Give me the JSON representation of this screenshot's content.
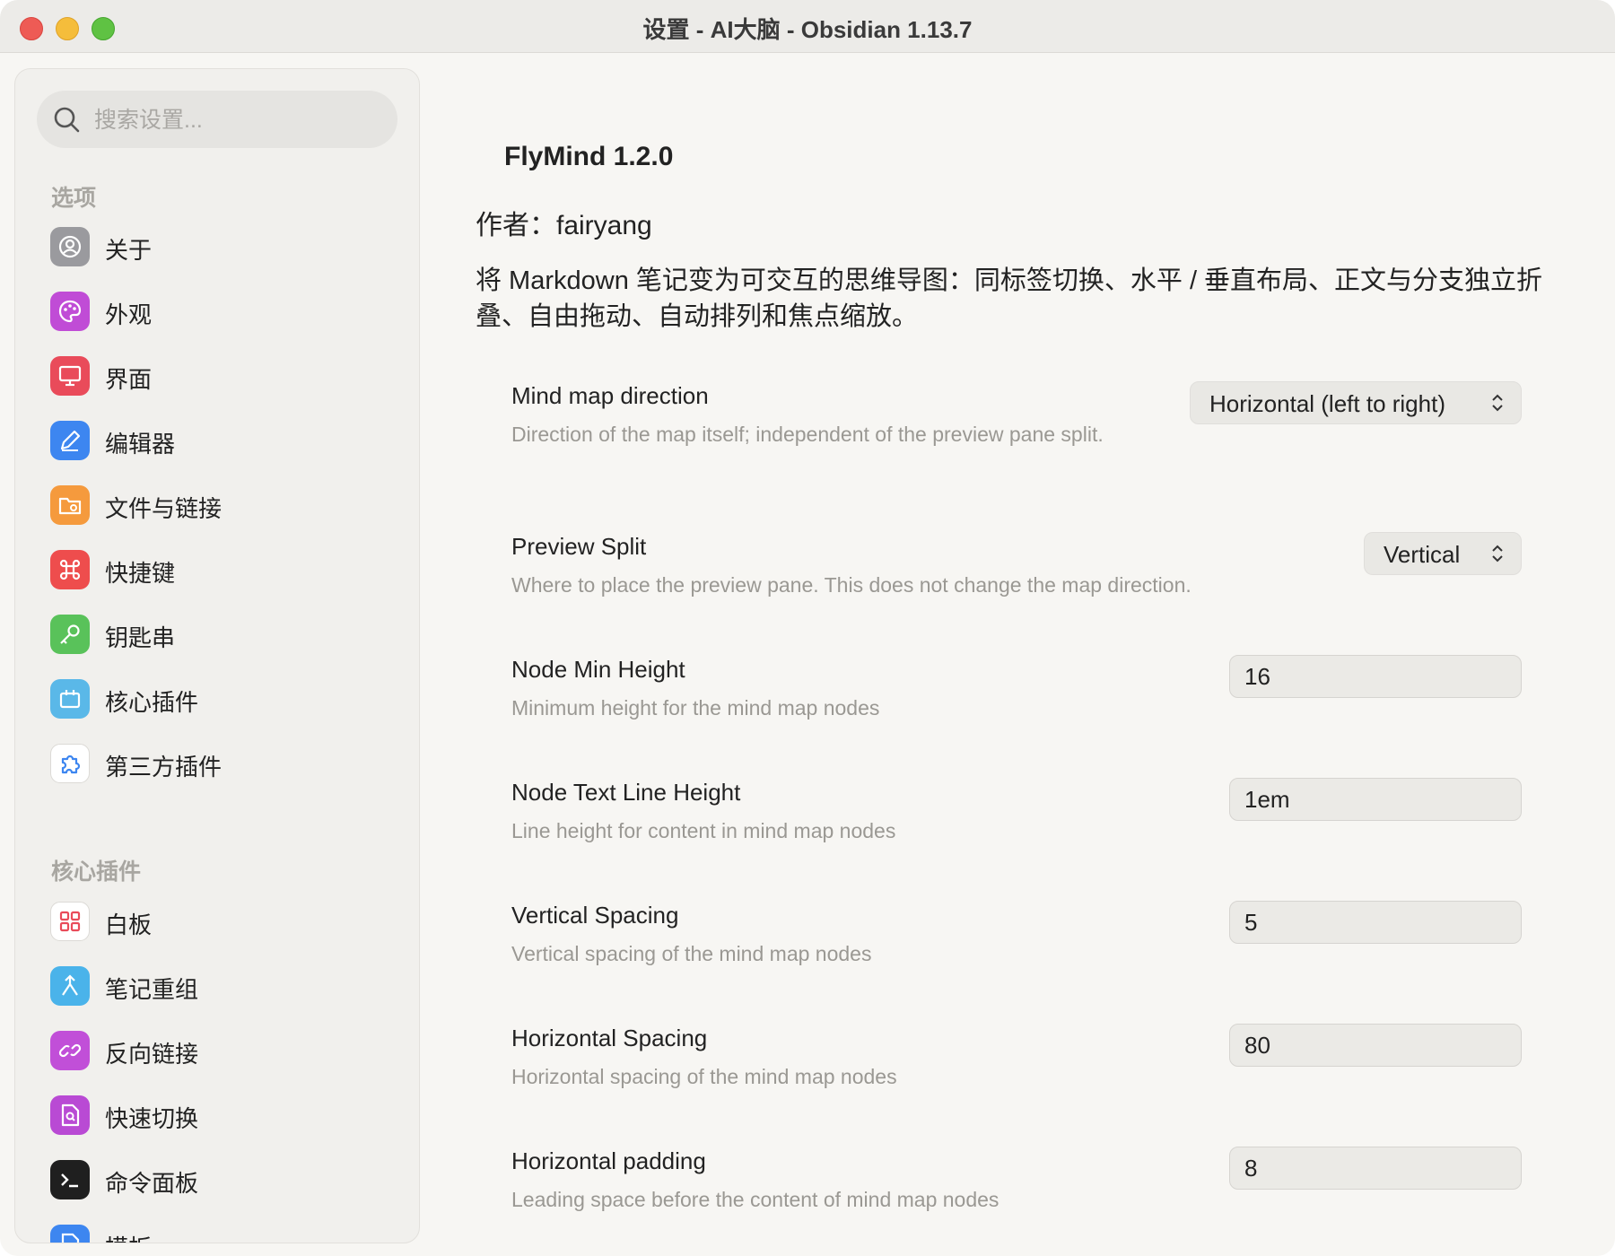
{
  "window": {
    "title": "设置 - AI大脑 - Obsidian 1.13.7"
  },
  "sidebar": {
    "search_placeholder": "搜索设置...",
    "sections": [
      {
        "label": "选项"
      },
      {
        "label": "核心插件"
      }
    ],
    "options_items": [
      {
        "label": "关于",
        "icon": "user-circle-icon",
        "color": "#8e8e93"
      },
      {
        "label": "外观",
        "icon": "palette-icon",
        "color": "#c04cd6"
      },
      {
        "label": "界面",
        "icon": "monitor-icon",
        "color": "#e94b5a"
      },
      {
        "label": "编辑器",
        "icon": "pencil-icon",
        "color": "#3d86f0"
      },
      {
        "label": "文件与链接",
        "icon": "folder-cog-icon",
        "color": "#f59a3d"
      },
      {
        "label": "快捷键",
        "icon": "command-icon",
        "color": "#ee4d4d"
      },
      {
        "label": "钥匙串",
        "icon": "key-icon",
        "color": "#59c25a"
      },
      {
        "label": "核心插件",
        "icon": "plug-box-icon",
        "color": "#5ab8e8"
      },
      {
        "label": "第三方插件",
        "icon": "puzzle-icon",
        "color": "#ffffff"
      }
    ],
    "core_items": [
      {
        "label": "白板",
        "icon": "layout-grid-icon",
        "color": "#ffffff"
      },
      {
        "label": "笔记重组",
        "icon": "merge-icon",
        "color": "#4ab3ea"
      },
      {
        "label": "反向链接",
        "icon": "backlink-icon",
        "color": "#c14fd8"
      },
      {
        "label": "快速切换",
        "icon": "file-search-icon",
        "color": "#b94ad4"
      },
      {
        "label": "命令面板",
        "icon": "terminal-icon",
        "color": "#1f1f1f"
      },
      {
        "label": "模板",
        "icon": "template-icon",
        "color": "#3d86f0"
      }
    ]
  },
  "plugin": {
    "title": "FlyMind 1.2.0",
    "author": "作者：fairyang",
    "description": "将 Markdown 笔记变为可交互的思维导图：同标签切换、水平 / 垂直布局、正文与分支独立折叠、自由拖动、自动排列和焦点缩放。"
  },
  "settings": [
    {
      "name": "Mind map direction",
      "desc": "Direction of the map itself; independent of the preview pane split.",
      "control": "select",
      "value": "Horizontal (left to right)"
    },
    {
      "name": "Preview Split",
      "desc": "Where to place the preview pane. This does not change the map direction.",
      "control": "select",
      "value": "Vertical"
    },
    {
      "name": "Node Min Height",
      "desc": "Minimum height for the mind map nodes",
      "control": "text",
      "value": "16"
    },
    {
      "name": "Node Text Line Height",
      "desc": "Line height for content in mind map nodes",
      "control": "text",
      "value": "1em"
    },
    {
      "name": "Vertical Spacing",
      "desc": "Vertical spacing of the mind map nodes",
      "control": "text",
      "value": "5"
    },
    {
      "name": "Horizontal Spacing",
      "desc": "Horizontal spacing of the mind map nodes",
      "control": "text",
      "value": "80"
    },
    {
      "name": "Horizontal padding",
      "desc": "Leading space before the content of mind map nodes",
      "control": "text",
      "value": "8"
    }
  ]
}
